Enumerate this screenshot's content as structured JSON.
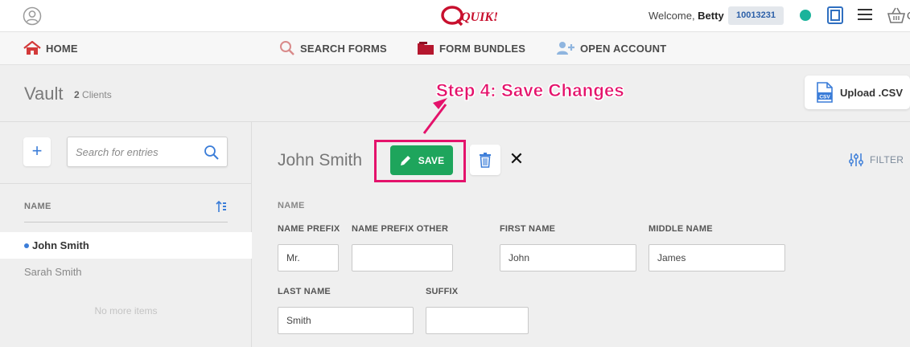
{
  "topbar": {
    "logo_text": "QUIK!",
    "welcome_prefix": "Welcome, ",
    "user_name": "Betty",
    "account_number": "10013231",
    "basket_label": "C"
  },
  "nav": {
    "items": [
      {
        "label": "HOME",
        "icon": "home-icon"
      },
      {
        "label": "SEARCH FORMS",
        "icon": "search-icon"
      },
      {
        "label": "FORM BUNDLES",
        "icon": "folder-icon"
      },
      {
        "label": "OPEN ACCOUNT",
        "icon": "add-user-icon"
      }
    ]
  },
  "vault": {
    "title": "Vault",
    "client_count": "2",
    "client_count_label": " Clients",
    "upload_label": "Upload .CSV"
  },
  "annotation": {
    "text": "Step 4: Save Changes"
  },
  "sidebar": {
    "add_label": "+",
    "search_placeholder": "Search for entries",
    "column_header": "NAME",
    "clients": [
      {
        "name": "John Smith",
        "active": true
      },
      {
        "name": "Sarah Smith",
        "active": false
      }
    ],
    "no_more_label": "No more items"
  },
  "record": {
    "name": "John Smith",
    "save_label": "SAVE",
    "filter_label": "FILTER",
    "section_label": "NAME",
    "fields": {
      "name_prefix": {
        "label": "NAME PREFIX",
        "value": "Mr."
      },
      "name_prefix_other": {
        "label": "NAME PREFIX OTHER",
        "value": ""
      },
      "first_name": {
        "label": "FIRST NAME",
        "value": "John"
      },
      "middle_name": {
        "label": "MIDDLE NAME",
        "value": "James"
      },
      "last_name": {
        "label": "LAST NAME",
        "value": "Smith"
      },
      "suffix": {
        "label": "SUFFIX",
        "value": ""
      }
    }
  },
  "colors": {
    "accent_pink": "#e4126b",
    "save_green": "#1ea55c",
    "status_teal": "#1bb39b",
    "link_blue": "#3b7dd8"
  }
}
